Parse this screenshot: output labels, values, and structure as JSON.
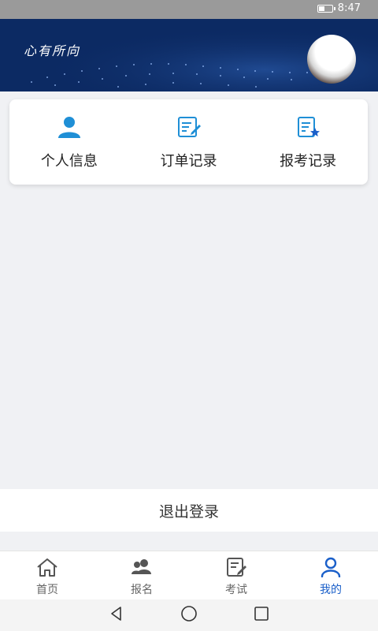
{
  "status_bar": {
    "time": "8:47"
  },
  "header": {
    "title": "心有所向"
  },
  "menu": [
    {
      "label": "个人信息",
      "icon": "person-icon"
    },
    {
      "label": "订单记录",
      "icon": "edit-document-icon"
    },
    {
      "label": "报考记录",
      "icon": "starred-document-icon"
    }
  ],
  "logout_label": "退出登录",
  "tabs": [
    {
      "label": "首页",
      "icon": "home-icon",
      "active": false
    },
    {
      "label": "报名",
      "icon": "users-icon",
      "active": false
    },
    {
      "label": "考试",
      "icon": "exam-edit-icon",
      "active": false
    },
    {
      "label": "我的",
      "icon": "profile-icon",
      "active": true
    }
  ],
  "colors": {
    "header_bg": "#0c2a63",
    "accent": "#1a5fc9",
    "menu_icon": "#1f8fd6"
  }
}
